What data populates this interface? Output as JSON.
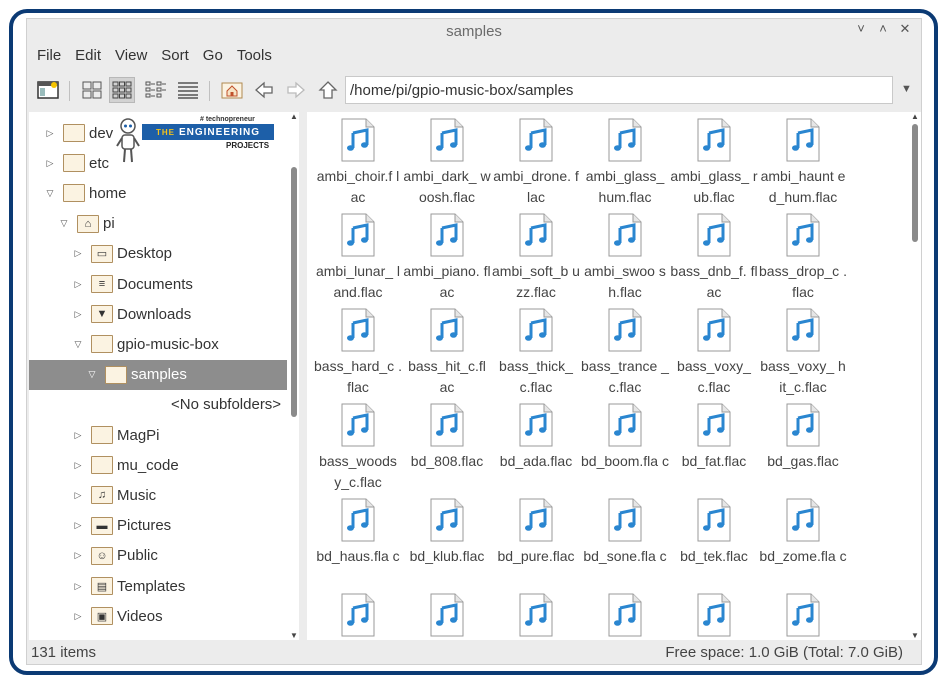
{
  "window": {
    "title": "samples",
    "controls": [
      "˅",
      "˄",
      "✕"
    ]
  },
  "menu": [
    "File",
    "Edit",
    "View",
    "Sort",
    "Go",
    "Tools"
  ],
  "toolbar": {
    "path": "/home/pi/gpio-music-box/samples",
    "icons": [
      "new-window-icon",
      "icon-view-icon",
      "compact-view-icon",
      "list-view-icon",
      "detail-view-icon",
      "home-icon",
      "back-icon",
      "forward-icon",
      "up-icon"
    ]
  },
  "logo": {
    "tagline": "# technopreneur",
    "the": "THE",
    "engineering": "ENGINEERING",
    "projects": "PROJECTS"
  },
  "sidebar": {
    "items": [
      {
        "label": "dev",
        "depth": 0,
        "exp": "▷",
        "icon": ""
      },
      {
        "label": "etc",
        "depth": 0,
        "exp": "▷",
        "icon": ""
      },
      {
        "label": "home",
        "depth": 0,
        "exp": "▽",
        "icon": ""
      },
      {
        "label": "pi",
        "depth": 1,
        "exp": "▽",
        "icon": "⌂"
      },
      {
        "label": "Desktop",
        "depth": 2,
        "exp": "▷",
        "icon": "▭"
      },
      {
        "label": "Documents",
        "depth": 2,
        "exp": "▷",
        "icon": "≡"
      },
      {
        "label": "Downloads",
        "depth": 2,
        "exp": "▷",
        "icon": "▼"
      },
      {
        "label": "gpio-music-box",
        "depth": 2,
        "exp": "▽",
        "icon": ""
      },
      {
        "label": "samples",
        "depth": 3,
        "exp": "▽",
        "icon": "",
        "selected": true
      },
      {
        "label": "<No subfolders>",
        "depth": 4,
        "exp": "",
        "icon": "none"
      },
      {
        "label": "MagPi",
        "depth": 2,
        "exp": "▷",
        "icon": ""
      },
      {
        "label": "mu_code",
        "depth": 2,
        "exp": "▷",
        "icon": ""
      },
      {
        "label": "Music",
        "depth": 2,
        "exp": "▷",
        "icon": "♫"
      },
      {
        "label": "Pictures",
        "depth": 2,
        "exp": "▷",
        "icon": "▬"
      },
      {
        "label": "Public",
        "depth": 2,
        "exp": "▷",
        "icon": "☺"
      },
      {
        "label": "Templates",
        "depth": 2,
        "exp": "▷",
        "icon": "▤"
      },
      {
        "label": "Videos",
        "depth": 2,
        "exp": "▷",
        "icon": "▣"
      }
    ]
  },
  "files": [
    "ambi_choir.f lac",
    "ambi_dark_ woosh.flac",
    "ambi_drone. flac",
    "ambi_glass_ hum.flac",
    "ambi_glass_ rub.flac",
    "ambi_haunt ed_hum.flac",
    "ambi_lunar_ land.flac",
    "ambi_piano. flac",
    "ambi_soft_b uzz.flac",
    "ambi_swoo sh.flac",
    "bass_dnb_f. flac",
    "bass_drop_c .flac",
    "bass_hard_c .flac",
    "bass_hit_c.fl ac",
    "bass_thick_ c.flac",
    "bass_trance _c.flac",
    "bass_voxy_ c.flac",
    "bass_voxy_ hit_c.flac",
    "bass_woods y_c.flac",
    "bd_808.flac",
    "bd_ada.flac",
    "bd_boom.fla c",
    "bd_fat.flac",
    "bd_gas.flac",
    "bd_haus.fla c",
    "bd_klub.flac",
    "bd_pure.flac",
    "bd_sone.fla c",
    "bd_tek.flac",
    "bd_zome.fla c",
    "",
    "",
    "",
    "",
    "",
    ""
  ],
  "status": {
    "items": "131 items",
    "free": "Free space: 1.0 GiB (Total: 7.0 GiB)"
  },
  "colors": {
    "frame": "#0b3a74",
    "selection": "#8d8d8d",
    "audio_icon": "#2a86d0"
  }
}
